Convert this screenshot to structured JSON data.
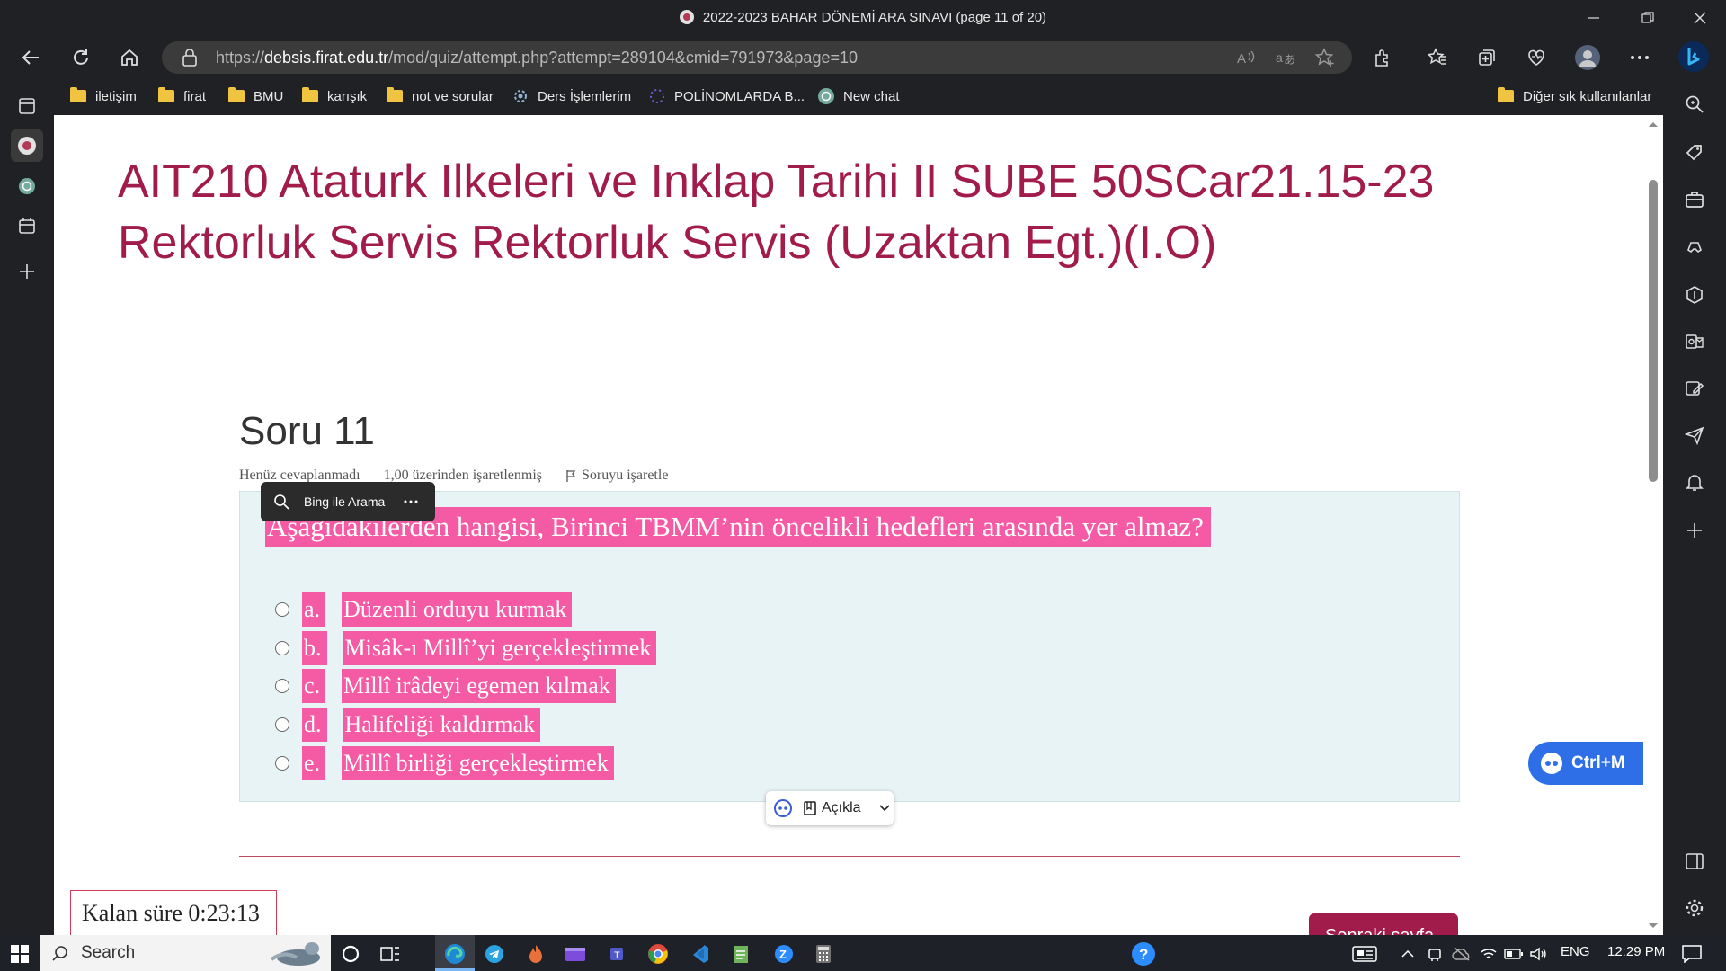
{
  "window": {
    "title": "2022-2023 BAHAR DÖNEMİ ARA SINAVI (page 11 of 20)"
  },
  "address": {
    "prefix": "https://",
    "host": "debsis.firat.edu.tr",
    "path": "/mod/quiz/attempt.php?attempt=289104&cmid=791973&page=10"
  },
  "bookmarks": [
    {
      "label": "iletişim",
      "icon": "folder-icon"
    },
    {
      "label": "firat",
      "icon": "folder-icon"
    },
    {
      "label": "BMU",
      "icon": "folder-icon"
    },
    {
      "label": "karışık",
      "icon": "folder-icon"
    },
    {
      "label": "not ve sorular",
      "icon": "folder-icon"
    },
    {
      "label": "Ders İşlemlerim",
      "icon": "gear-bookmark-icon"
    },
    {
      "label": "POLİNOMLARDA B...",
      "icon": "dots-icon"
    },
    {
      "label": "New chat",
      "icon": "chatgpt-icon"
    }
  ],
  "other_bookmarks": "Diğer sık kullanılanlar",
  "course_title": "AIT210 Ataturk Ilkeleri ve Inklap Tarihi II SUBE 50SCar21.15-23 Rektorluk Servis Rektorluk Servis (Uzaktan Egt.)(I.O)",
  "question": {
    "heading": "Soru 11",
    "status": "Henüz cevaplanmadı",
    "marks": "1,00 üzerinden işaretlenmiş",
    "flag": "Soruyu işaretle",
    "text": "Aşağıdakilerden hangisi, Birinci TBMM’nin öncelikli hedefleri arasında yer almaz?",
    "options": [
      {
        "letter": "a.",
        "text": "Düzenli orduyu kurmak"
      },
      {
        "letter": "b.",
        "text": "Misâk-ı Millî’yi gerçekleştirmek"
      },
      {
        "letter": "c.",
        "text": "Millî irâdeyi egemen kılmak"
      },
      {
        "letter": "d.",
        "text": "Halifeliği kaldırmak"
      },
      {
        "letter": "e.",
        "text": "Millî birliği gerçekleştirmek"
      }
    ]
  },
  "popups": {
    "bing_search": "Bing ile Arama",
    "explain": "Açıkla",
    "shortcut": "Ctrl+M"
  },
  "timer": "Kalan süre 0:23:13",
  "next_button": "Sonraki sayfa",
  "taskbar": {
    "search_placeholder": "Search",
    "language": "ENG",
    "time": "12:29 PM"
  },
  "colors": {
    "accent": "#a21c4b",
    "highlight": "#f55ba4",
    "question_bg": "#e7f3f5",
    "chrome": "#202124"
  }
}
